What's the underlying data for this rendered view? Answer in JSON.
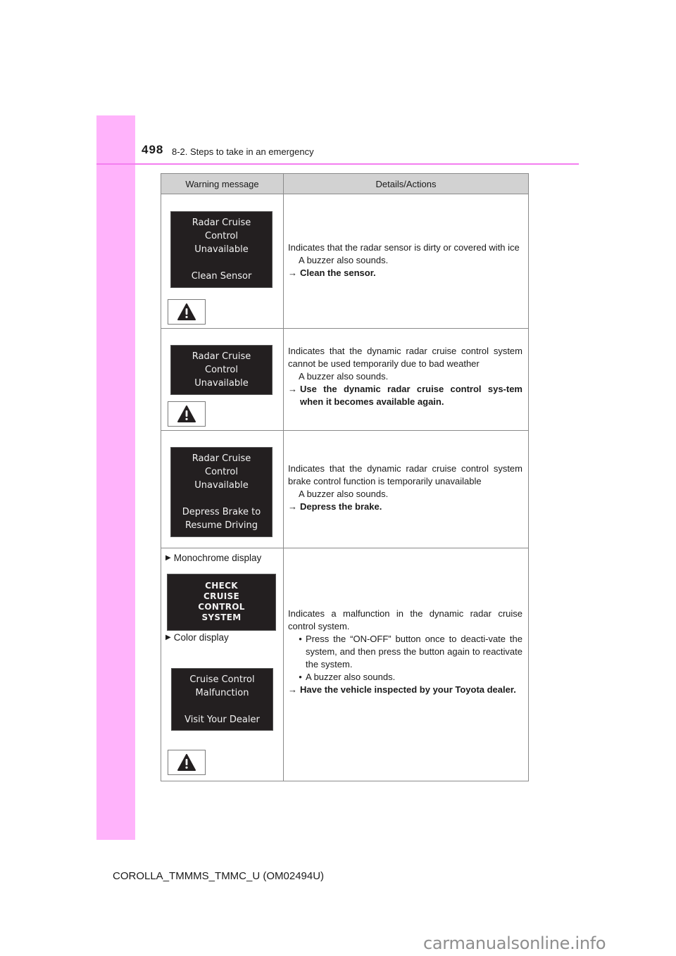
{
  "header": {
    "page_number": "498",
    "section_title": "8-2. Steps to take in an emergency"
  },
  "table": {
    "columns": [
      "Warning message",
      "Details/Actions"
    ],
    "rows": [
      {
        "display_lines": [
          "Radar Cruise",
          "Control",
          "Unavailable",
          "",
          "Clean Sensor"
        ],
        "has_warning_icon": true,
        "description": "Indicates that the radar sensor is dirty or covered with ice",
        "note": "A buzzer also sounds.",
        "action": "Clean the sensor."
      },
      {
        "display_lines": [
          "Radar Cruise",
          "Control",
          "Unavailable"
        ],
        "has_warning_icon": true,
        "description": "Indicates that the dynamic radar cruise control system cannot be used temporarily due to bad weather",
        "note": "A buzzer also sounds.",
        "action": "Use the dynamic radar cruise control sys-tem when it becomes available again."
      },
      {
        "display_lines": [
          "Radar Cruise",
          "Control",
          "Unavailable",
          "",
          "Depress Brake to",
          "Resume Driving"
        ],
        "has_warning_icon": false,
        "description": "Indicates that the dynamic radar cruise control system brake control function is temporarily unavailable",
        "note": "A buzzer also sounds.",
        "action": "Depress the brake."
      },
      {
        "monochrome_label": "Monochrome display",
        "monochrome_lines": [
          "CHECK",
          "CRUISE",
          "CONTROL",
          "SYSTEM"
        ],
        "color_label": "Color display",
        "color_lines": [
          "Cruise Control",
          "Malfunction",
          "",
          "Visit Your Dealer"
        ],
        "has_warning_icon": true,
        "description": "Indicates a malfunction in the dynamic radar cruise control system.",
        "bullets": [
          "Press the “ON-OFF” button once to deacti-vate the system, and then press the button again to reactivate the system.",
          "A buzzer also sounds."
        ],
        "action": "Have the vehicle inspected by your Toyota dealer."
      }
    ]
  },
  "symbols": {
    "arrow": "→",
    "bullet": "•",
    "triangle": "▶",
    "warning_icon": "warning-triangle-icon"
  },
  "footer": {
    "doc_id": "COROLLA_TMMMS_TMMC_U (OM02494U)"
  },
  "watermark": "carmanualsonline.info",
  "colors": {
    "sidebar": "#ffb3fb",
    "header_line": "#f47ef0",
    "table_header_bg": "#d2d2d2",
    "lcd_bg": "#231f20"
  }
}
